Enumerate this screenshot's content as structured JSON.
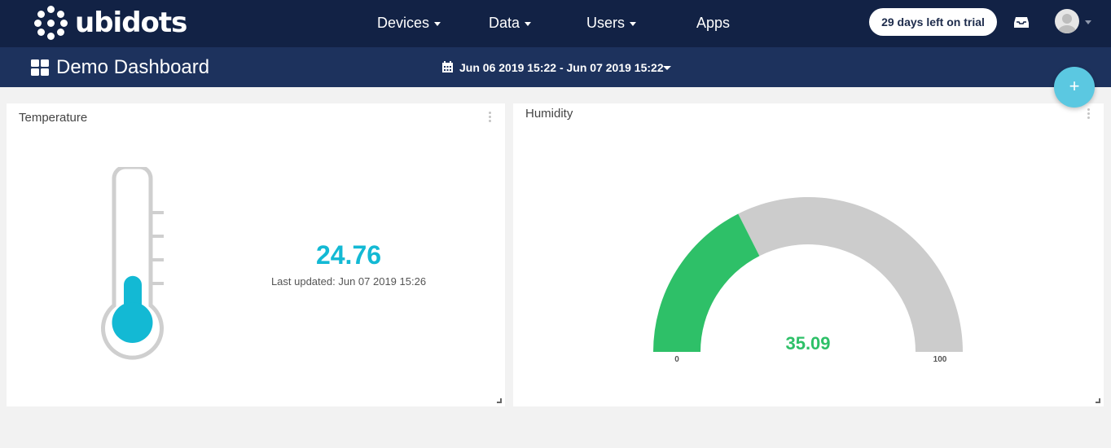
{
  "app": {
    "brand": "ubidots"
  },
  "nav": {
    "items": [
      {
        "label": "Devices",
        "has_dropdown": true
      },
      {
        "label": "Data",
        "has_dropdown": true
      },
      {
        "label": "Users",
        "has_dropdown": true
      },
      {
        "label": "Apps",
        "has_dropdown": false
      }
    ],
    "trial_badge": "29 days left on trial",
    "inbox_icon": "inbox-icon",
    "avatar_icon": "user-avatar-icon"
  },
  "dashboard": {
    "title": "Demo Dashboard",
    "icon": "dashboard-grid-icon",
    "date_range": "Jun 06 2019 15:22 - Jun 07 2019 15:22",
    "add_button": "+"
  },
  "widgets": {
    "temperature": {
      "title": "Temperature",
      "value": "24.76",
      "last_updated": "Last updated: Jun 07 2019 15:26",
      "fill_fraction": 0.36,
      "color": "#13b9d4"
    },
    "humidity": {
      "title": "Humidity",
      "value": "35.09",
      "min": "0",
      "max": "100",
      "gauge_value": 35.09,
      "gauge_min": 0,
      "gauge_max": 100,
      "fill_color": "#2ec068",
      "track_color": "#cccccc"
    }
  },
  "colors": {
    "topbar": "#122245",
    "subbar": "#1d325d",
    "accent": "#5bc8e1"
  }
}
